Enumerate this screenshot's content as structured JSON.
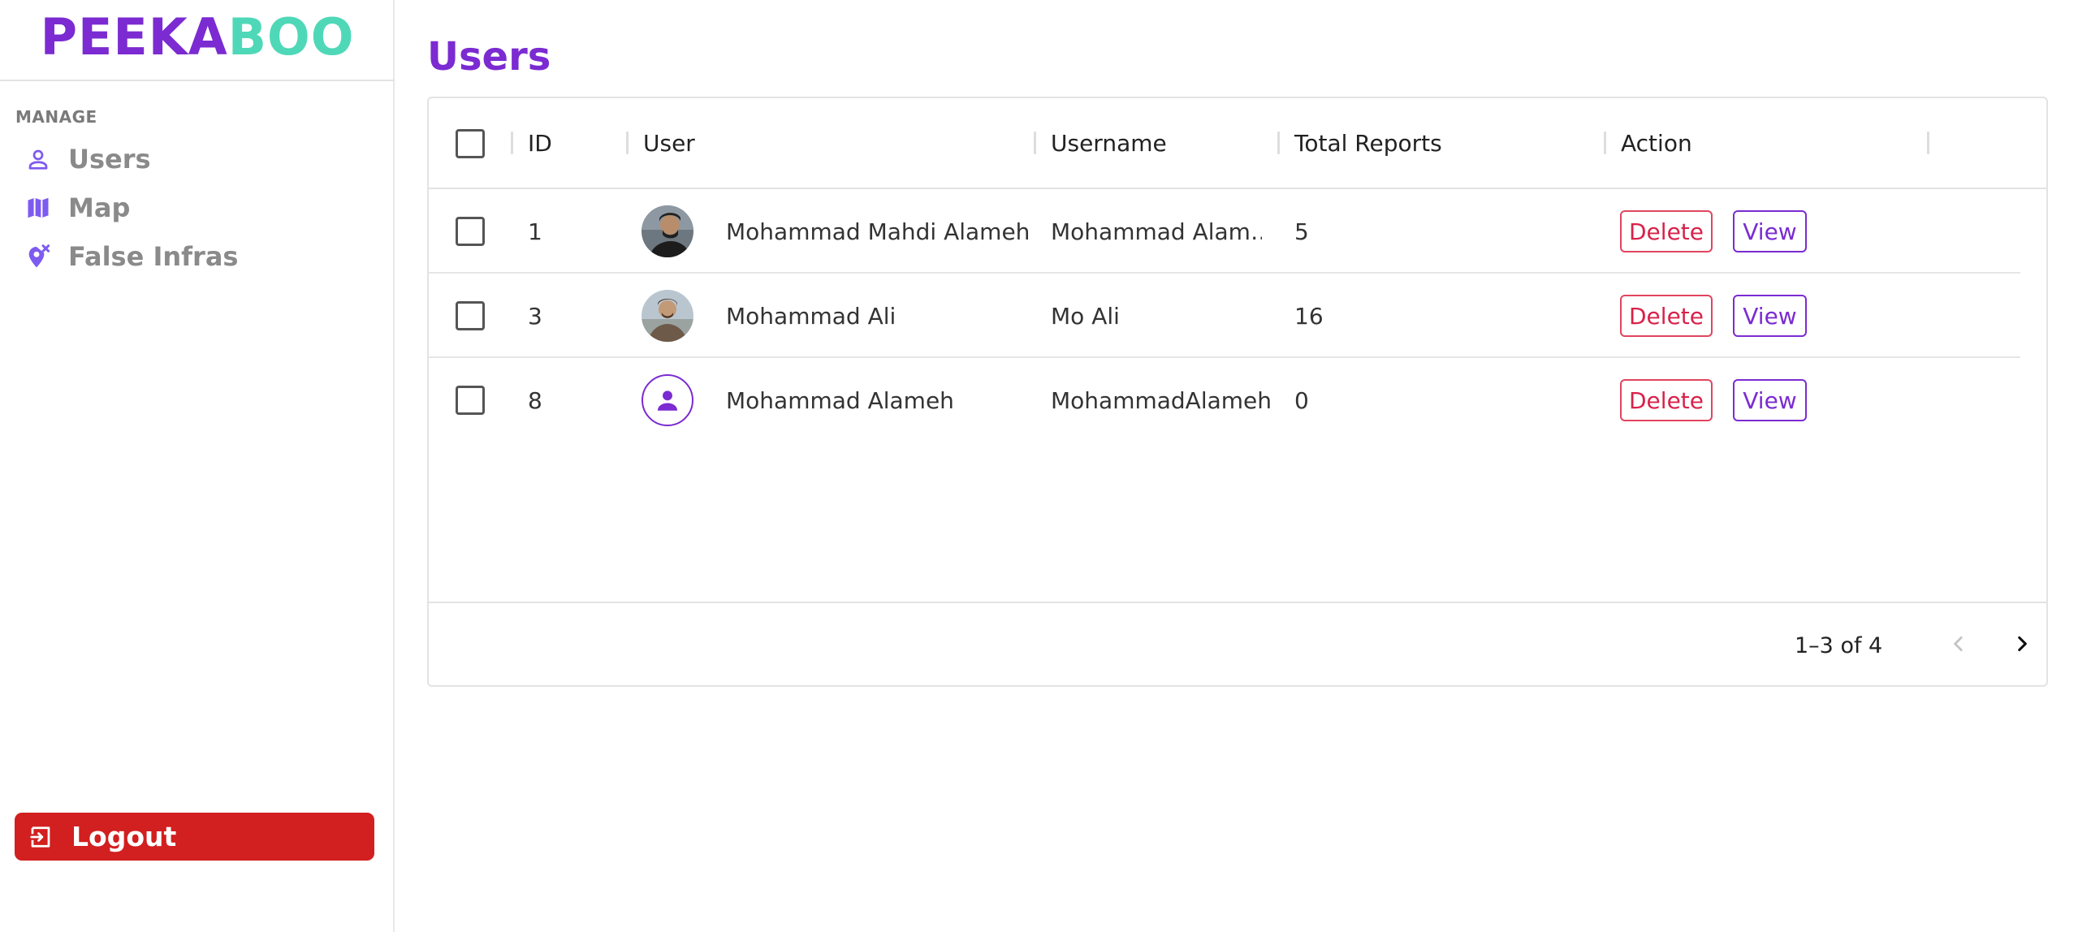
{
  "brand": {
    "part1": "PEEKA",
    "part2": "BOO"
  },
  "sidebar": {
    "section_label": "MANAGE",
    "items": [
      {
        "label": "Users",
        "icon": "person-outline-icon"
      },
      {
        "label": "Map",
        "icon": "map-icon"
      },
      {
        "label": "False Infras",
        "icon": "location-off-icon"
      }
    ],
    "logout_label": "Logout"
  },
  "page": {
    "title": "Users"
  },
  "table": {
    "columns": [
      "ID",
      "User",
      "Username",
      "Total Reports",
      "Action"
    ],
    "rows": [
      {
        "id": "1",
        "name": "Mohammad Mahdi Alameh",
        "username": "Mohammad Alam…",
        "reports": "5",
        "avatar": "photo"
      },
      {
        "id": "3",
        "name": "Mohammad Ali",
        "username": "Mo Ali",
        "reports": "16",
        "avatar": "photo"
      },
      {
        "id": "8",
        "name": "Mohammad Alameh",
        "username": "MohammadAlameh",
        "reports": "0",
        "avatar": "default-person-icon"
      }
    ],
    "actions": {
      "delete_label": "Delete",
      "view_label": "View"
    },
    "pagination": {
      "text": "1–3 of 4"
    }
  },
  "colors": {
    "brand_purple": "#7b2bd1",
    "brand_teal": "#4fd8b7",
    "logout_red": "#d21f1f",
    "delete_red": "#d8224a",
    "nav_icon": "#7e5bef"
  }
}
